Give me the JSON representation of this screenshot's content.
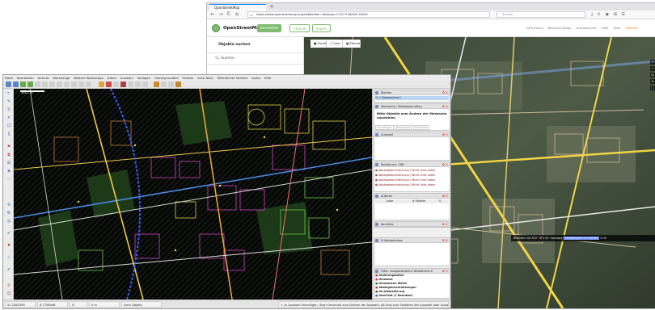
{
  "colors": {
    "id_green_button": "#7ebc6f",
    "josm_bg": "#050805",
    "id_version_badge": "#7092ff"
  },
  "browser": {
    "tab_title": "OpenStreetMap",
    "new_tab": "+",
    "url": "https://www.openstreetmap.org/edit#editor=id&map=17/57.22849/5.78245",
    "search_placeholder": "Suchen",
    "nav_back": "←",
    "nav_forward": "→",
    "nav_reload": "C",
    "nav_home": "⌂",
    "toolbar_icons": "⤓ ⊪ ◉ ⊞ ☰"
  },
  "id_editor": {
    "brand": "OpenStreetMap",
    "edit_button": "Bearbeiten",
    "history_button": "Chronik",
    "export_button": "Export",
    "links": [
      "GPS-Tracks",
      "Benutzer-Blogs",
      "Urheberrecht",
      "Hilfe",
      "Über"
    ],
    "user": "Wrenne",
    "sidebar_title": "Objekte suchen",
    "sidebar_search": "Suchen",
    "tools": {
      "point": "Punkt",
      "line": "Linie",
      "area": "Fläche"
    },
    "right_controls": [
      "+",
      "−",
      "◎",
      "≡",
      "⬚"
    ],
    "footer_text": "Bilddaten von Esri · iD 2.14 · Kontakte",
    "footer_version": "Einstellungen zur Version",
    "footer_count": "4 OK"
  },
  "josm": {
    "menu": [
      "Datei",
      "Bearbeiten",
      "Ansicht",
      "Werkzeuge",
      "Weitere Werkzeuge",
      "Daten",
      "Auswahl",
      "Vorlagen",
      "Hintergrundbild",
      "Fenster",
      "Auto Tools",
      "Öffentlicher Verkehr",
      "Audio",
      "Hilfe"
    ],
    "scale": "144.1 m",
    "layers_panel": {
      "title": "Ebenen",
      "items": [
        "Datenebene 1"
      ]
    },
    "tags_panel": {
      "title": "Merkmale / Mitgliedschaften",
      "message": "Bitte Objekte zum Ändern der Merkmale auswählen.",
      "buttons": [
        "Hinzufügen",
        "Bearbeiten",
        "Entfernen"
      ]
    },
    "selection_panel": {
      "title": "Auswahl"
    },
    "relations_panel": {
      "title": "Relationen: 168",
      "items": [
        "Abbiegebeschränkung (\"Nicht links abbie",
        "Abbiegebeschränkung (\"Nicht links abbie",
        "Abbiegebeschränkung (\"Nicht links abbie",
        "Abbiegebeschränkung (\"Nicht links abbie"
      ]
    },
    "authors_panel": {
      "title": "Autoren",
      "columns": [
        "Autor",
        "# Objekte",
        "%"
      ]
    },
    "conflicts_panel": {
      "title": "Konflikte"
    },
    "validation_panel": {
      "title": "Prüfergebnisse"
    },
    "filter_panel": {
      "title": "Filter: Ausgeblendet:0 Deaktiviert:0",
      "items": [
        "Änderungssätze",
        "Hinweise",
        "Unmessene Werte",
        "Abbiegeinschränkungen",
        "de.wikipedia.org",
        "OsmChat (1 Benutzer)"
      ]
    },
    "status": {
      "lat": "51.2261599",
      "lon": "6.7756546",
      "angle": "0°",
      "distance": "0 m",
      "selection": "(kein Objekt)",
      "hint": "+ zu Auswahl hinzufügen, Strg+Umschalt zum Drehen der Auswahl; Alt-Strg zum Skalieren der Auswahl oder Auswahl ändern"
    }
  }
}
